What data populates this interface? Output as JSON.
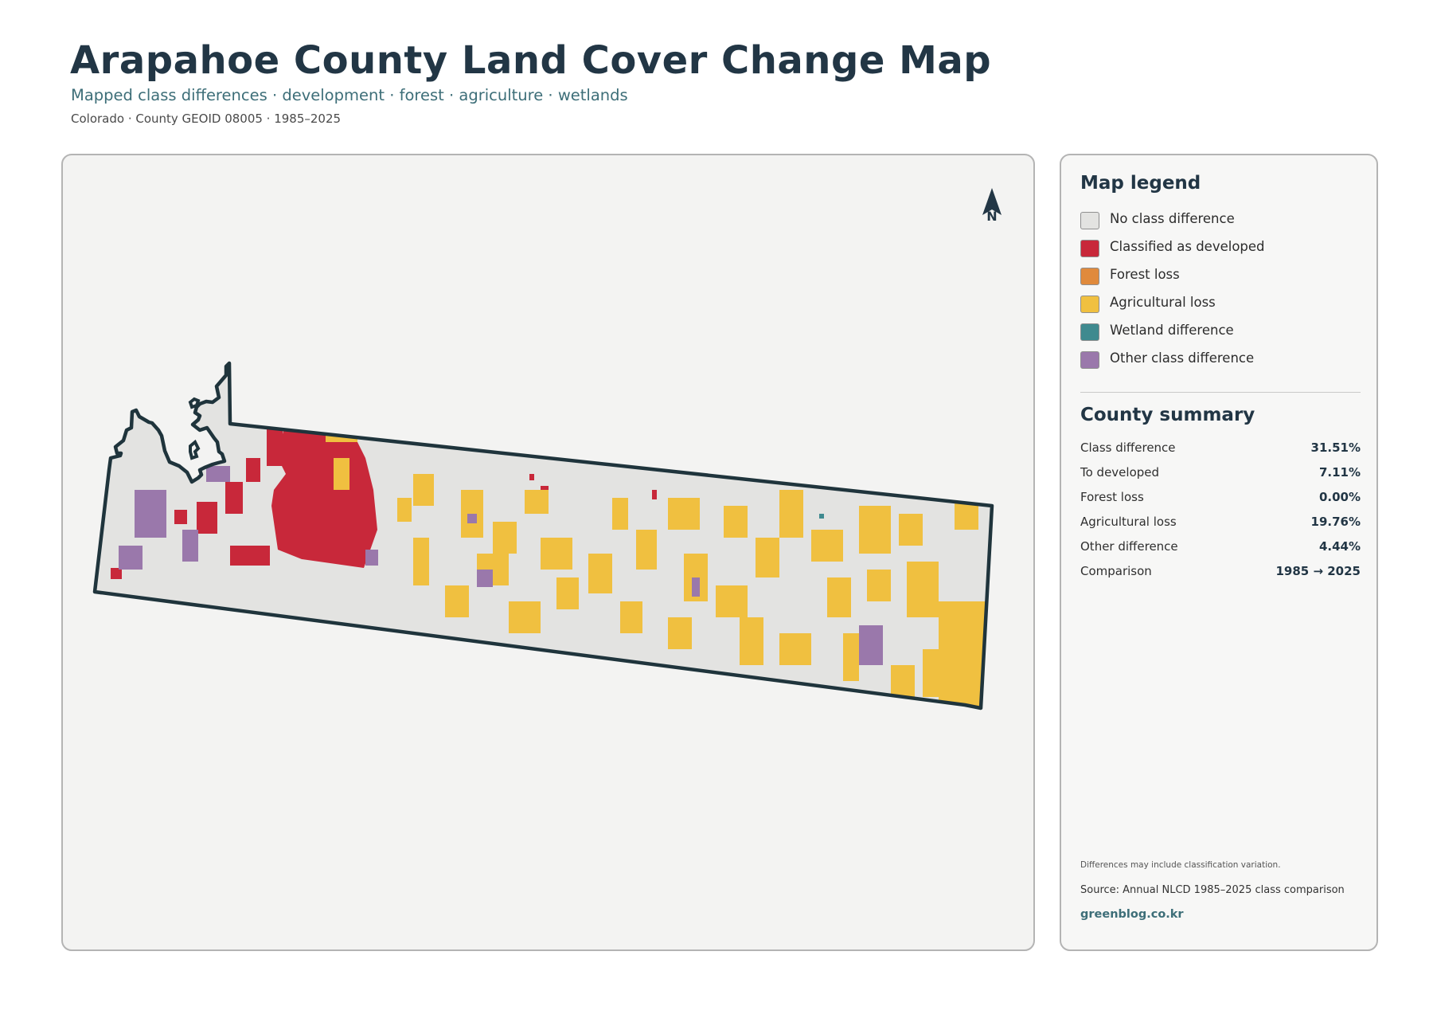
{
  "header": {
    "title": "Arapahoe County Land Cover Change Map",
    "subtitle": "Mapped class differences · development · forest · agriculture · wetlands",
    "meta": "Colorado · County GEOID 08005 · 1985–2025"
  },
  "map": {
    "north_label": "N",
    "icons": {
      "north_arrow": "north-arrow-icon"
    },
    "colors": {
      "no_difference": "#e3e3e1",
      "developed": "#c8283a",
      "forest_loss": "#e08a3c",
      "agricultural_loss": "#f0c040",
      "wetland": "#3f8a8f",
      "other": "#9a78ab",
      "boundary": "#1f343c"
    }
  },
  "legend": {
    "title": "Map legend",
    "items": [
      {
        "label": "No class difference",
        "color": "#e3e3e1"
      },
      {
        "label": "Classified as developed",
        "color": "#c8283a"
      },
      {
        "label": "Forest loss",
        "color": "#e08a3c"
      },
      {
        "label": "Agricultural loss",
        "color": "#f0c040"
      },
      {
        "label": "Wetland difference",
        "color": "#3f8a8f"
      },
      {
        "label": "Other class difference",
        "color": "#9a78ab"
      }
    ]
  },
  "summary": {
    "title": "County summary",
    "rows": [
      {
        "label": "Class difference",
        "value": "31.51%"
      },
      {
        "label": "To developed",
        "value": "7.11%"
      },
      {
        "label": "Forest loss",
        "value": "0.00%"
      },
      {
        "label": "Agricultural loss",
        "value": "19.76%"
      },
      {
        "label": "Other difference",
        "value": "4.44%"
      },
      {
        "label": "Comparison",
        "value": "1985 → 2025"
      }
    ]
  },
  "footer": {
    "note": "Differences may include classification variation.",
    "source": "Source: Annual NLCD 1985–2025 class comparison",
    "site": "greenblog.co.kr"
  }
}
